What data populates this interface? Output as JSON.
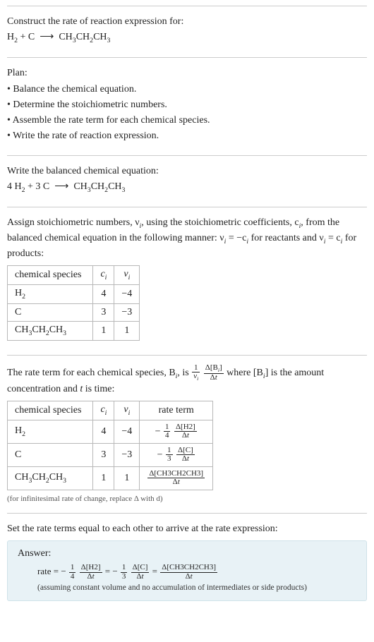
{
  "prompt": {
    "title": "Construct the rate of reaction expression for:",
    "equation_left": "H",
    "equation": "H₂ + C ⟶ CH₃CH₂CH₃"
  },
  "plan": {
    "heading": "Plan:",
    "items": [
      "Balance the chemical equation.",
      "Determine the stoichiometric numbers.",
      "Assemble the rate term for each chemical species.",
      "Write the rate of reaction expression."
    ]
  },
  "balanced": {
    "heading": "Write the balanced chemical equation:",
    "equation": "4 H₂ + 3 C ⟶ CH₃CH₂CH₃"
  },
  "stoich": {
    "intro_a": "Assign stoichiometric numbers, ν",
    "intro_b": ", using the stoichiometric coefficients, c",
    "intro_c": ", from the balanced chemical equation in the following manner: ν",
    "intro_d": " = −c",
    "intro_e": " for reactants and ν",
    "intro_f": " = c",
    "intro_g": " for products:",
    "headers": [
      "chemical species",
      "cᵢ",
      "νᵢ"
    ],
    "rows": [
      {
        "species": "H₂",
        "c": "4",
        "v": "−4"
      },
      {
        "species": "C",
        "c": "3",
        "v": "−3"
      },
      {
        "species": "CH₃CH₂CH₃",
        "c": "1",
        "v": "1"
      }
    ]
  },
  "rateterm": {
    "intro_a": "The rate term for each chemical species, B",
    "intro_b": ", is ",
    "frac1_num": "1",
    "frac1_den": "νᵢ",
    "frac2_num": "Δ[Bᵢ]",
    "frac2_den": "Δt",
    "intro_c": " where [B",
    "intro_d": "] is the amount concentration and ",
    "intro_e": " is time:",
    "t_label": "t",
    "headers": [
      "chemical species",
      "cᵢ",
      "νᵢ",
      "rate term"
    ],
    "rows": [
      {
        "species": "H₂",
        "c": "4",
        "v": "−4",
        "pref": "−",
        "coef_num": "1",
        "coef_den": "4",
        "d_num": "Δ[H2]",
        "d_den": "Δt"
      },
      {
        "species": "C",
        "c": "3",
        "v": "−3",
        "pref": "−",
        "coef_num": "1",
        "coef_den": "3",
        "d_num": "Δ[C]",
        "d_den": "Δt"
      },
      {
        "species": "CH₃CH₂CH₃",
        "c": "1",
        "v": "1",
        "pref": "",
        "coef_num": "",
        "coef_den": "",
        "d_num": "Δ[CH3CH2CH3]",
        "d_den": "Δt"
      }
    ],
    "note": "(for infinitesimal rate of change, replace Δ with d)"
  },
  "final": {
    "heading": "Set the rate terms equal to each other to arrive at the rate expression:",
    "answer_label": "Answer:",
    "rate_word": "rate",
    "eq": " = −",
    "f1_num": "1",
    "f1_den": "4",
    "d1_num": "Δ[H2]",
    "d1_den": "Δt",
    "mid1": " = −",
    "f2_num": "1",
    "f2_den": "3",
    "d2_num": "Δ[C]",
    "d2_den": "Δt",
    "mid2": " = ",
    "d3_num": "Δ[CH3CH2CH3]",
    "d3_den": "Δt",
    "assume": "(assuming constant volume and no accumulation of intermediates or side products)"
  },
  "chart_data": {
    "type": "table",
    "tables": [
      {
        "title": "Stoichiometric numbers",
        "columns": [
          "chemical species",
          "c_i",
          "ν_i"
        ],
        "rows": [
          [
            "H2",
            4,
            -4
          ],
          [
            "C",
            3,
            -3
          ],
          [
            "CH3CH2CH3",
            1,
            1
          ]
        ]
      },
      {
        "title": "Rate terms",
        "columns": [
          "chemical species",
          "c_i",
          "ν_i",
          "rate term"
        ],
        "rows": [
          [
            "H2",
            4,
            -4,
            "-(1/4) Δ[H2]/Δt"
          ],
          [
            "C",
            3,
            -3,
            "-(1/3) Δ[C]/Δt"
          ],
          [
            "CH3CH2CH3",
            1,
            1,
            "Δ[CH3CH2CH3]/Δt"
          ]
        ]
      }
    ]
  }
}
